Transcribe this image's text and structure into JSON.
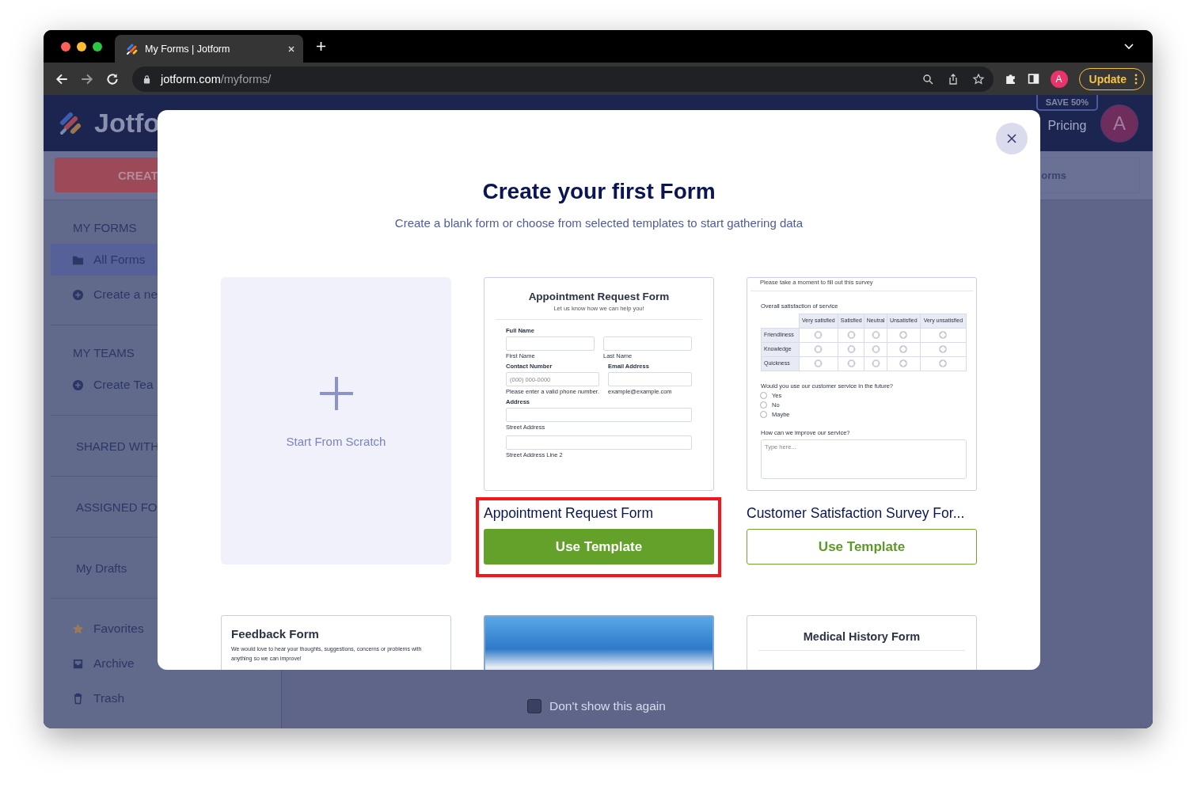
{
  "browser": {
    "tab_title": "My Forms | Jotform",
    "url_host": "jotform.com",
    "url_path": "/myforms/",
    "profile_initial": "A",
    "update_label": "Update"
  },
  "header": {
    "logo_text": "Jotfo",
    "badge": "SAVE 50%",
    "pricing": "Pricing",
    "avatar_initial": "A"
  },
  "toolbar": {
    "create_button": "CREAT",
    "tab_label": "orms"
  },
  "sidebar": {
    "sections": [
      {
        "items": [
          {
            "kind": "heading",
            "label": "MY FORMS"
          },
          {
            "kind": "folder",
            "label": "All Forms",
            "selected": true
          },
          {
            "kind": "create",
            "label": "Create a ne",
            "selected": false
          }
        ]
      },
      {
        "items": [
          {
            "kind": "heading",
            "label": "MY TEAMS"
          },
          {
            "kind": "create",
            "label": "Create Tea",
            "selected": false
          }
        ]
      },
      {
        "items": [
          {
            "kind": "plain",
            "label": "SHARED WITH",
            "selected": false
          }
        ]
      },
      {
        "items": [
          {
            "kind": "plain",
            "label": "ASSIGNED FO",
            "selected": false
          }
        ]
      },
      {
        "items": [
          {
            "kind": "plain",
            "label": "My Drafts",
            "selected": false
          }
        ]
      },
      {
        "items": [
          {
            "kind": "star",
            "label": "Favorites",
            "selected": false
          },
          {
            "kind": "archive",
            "label": "Archive",
            "selected": false
          },
          {
            "kind": "trash",
            "label": "Trash",
            "selected": false
          }
        ]
      }
    ]
  },
  "modal": {
    "title": "Create your first Form",
    "subtitle": "Create a blank form or choose from selected templates to start gathering data",
    "scratch_label": "Start From Scratch",
    "templates": [
      {
        "title": "Appointment Request Form",
        "button_label": "Use Template",
        "filled": true,
        "highlighted": true,
        "preview": {
          "kind": "appointment",
          "heading": "Appointment Request Form",
          "subheading": "Let us know how we can help you!",
          "rows": [
            {
              "cells": [
                {
                  "label": "Full Name",
                  "sublabel": "First Name"
                },
                {
                  "sublabel": "Last Name"
                }
              ]
            },
            {
              "cells": [
                {
                  "label": "Contact Number",
                  "placeholder": "(000) 000-0000",
                  "sublabel": "Please enter a valid phone number."
                },
                {
                  "label": "Email Address",
                  "sublabel": "example@example.com"
                }
              ]
            },
            {
              "cells": [
                {
                  "label": "Address",
                  "sublabel": "Street Address"
                }
              ]
            },
            {
              "cells": [
                {
                  "sublabel": "Street Address Line 2"
                }
              ]
            }
          ]
        }
      },
      {
        "title": "Customer Satisfaction Survey For...",
        "button_label": "Use Template",
        "filled": false,
        "highlighted": false,
        "preview": {
          "kind": "survey",
          "intro": "Please take a moment to fill out this survey",
          "matrix_title": "Overall satisfaction of service",
          "columns": [
            "Very satisfied",
            "Satisfied",
            "Neutral",
            "Unsatisfied",
            "Very unsatisfied"
          ],
          "rows": [
            "Friendliness",
            "Knowledge",
            "Quickness"
          ],
          "question": "Would you use our customer service in the future?",
          "options": [
            {
              "label": "Yes",
              "checked": false
            },
            {
              "label": "No",
              "checked": false
            },
            {
              "label": "Maybe",
              "checked": false
            }
          ],
          "question_2": "How can we improve our service?",
          "textarea_placeholder": "Type here..."
        }
      }
    ],
    "more_templates": [
      {
        "kind": "text",
        "title": "Feedback Form",
        "description": "We would love to hear your thoughts, suggestions, concerns or problems with anything so we can improve!"
      },
      {
        "kind": "photo"
      },
      {
        "kind": "form",
        "title": "Medical History Form"
      }
    ]
  },
  "dont_show": {
    "label": "Don't show this again",
    "checked": false
  }
}
